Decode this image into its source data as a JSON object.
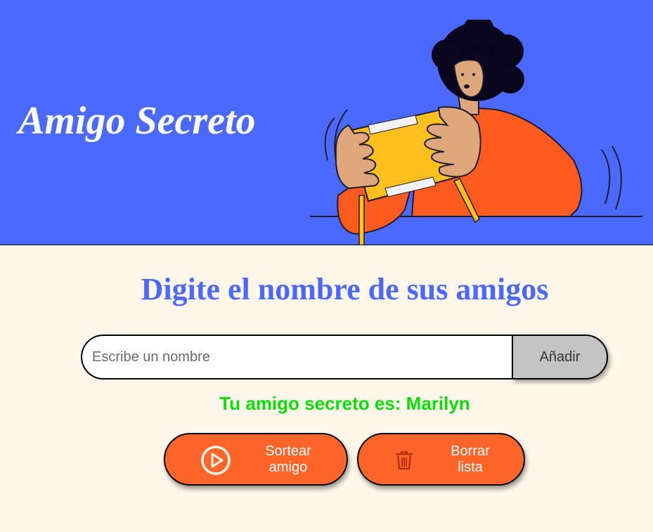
{
  "header": {
    "title": "Amigo Secreto",
    "background_color": "#4b69fd"
  },
  "main": {
    "heading": "Digite el nombre de sus amigos",
    "input": {
      "placeholder": "Escribe un nombre",
      "value": ""
    },
    "add_button_label": "Añadir",
    "result_text": "Tu amigo secreto es: Marilyn",
    "buttons": {
      "draw": {
        "label_line1": "Sortear",
        "label_line2": "amigo",
        "icon": "play-circle-icon"
      },
      "clear": {
        "label_line1": "Borrar",
        "label_line2": "lista",
        "icon": "trash-icon"
      }
    }
  },
  "colors": {
    "accent_blue": "#4b69fd",
    "button_orange": "#fe652b",
    "result_green": "#05df05",
    "page_background": "#fff7ea"
  }
}
